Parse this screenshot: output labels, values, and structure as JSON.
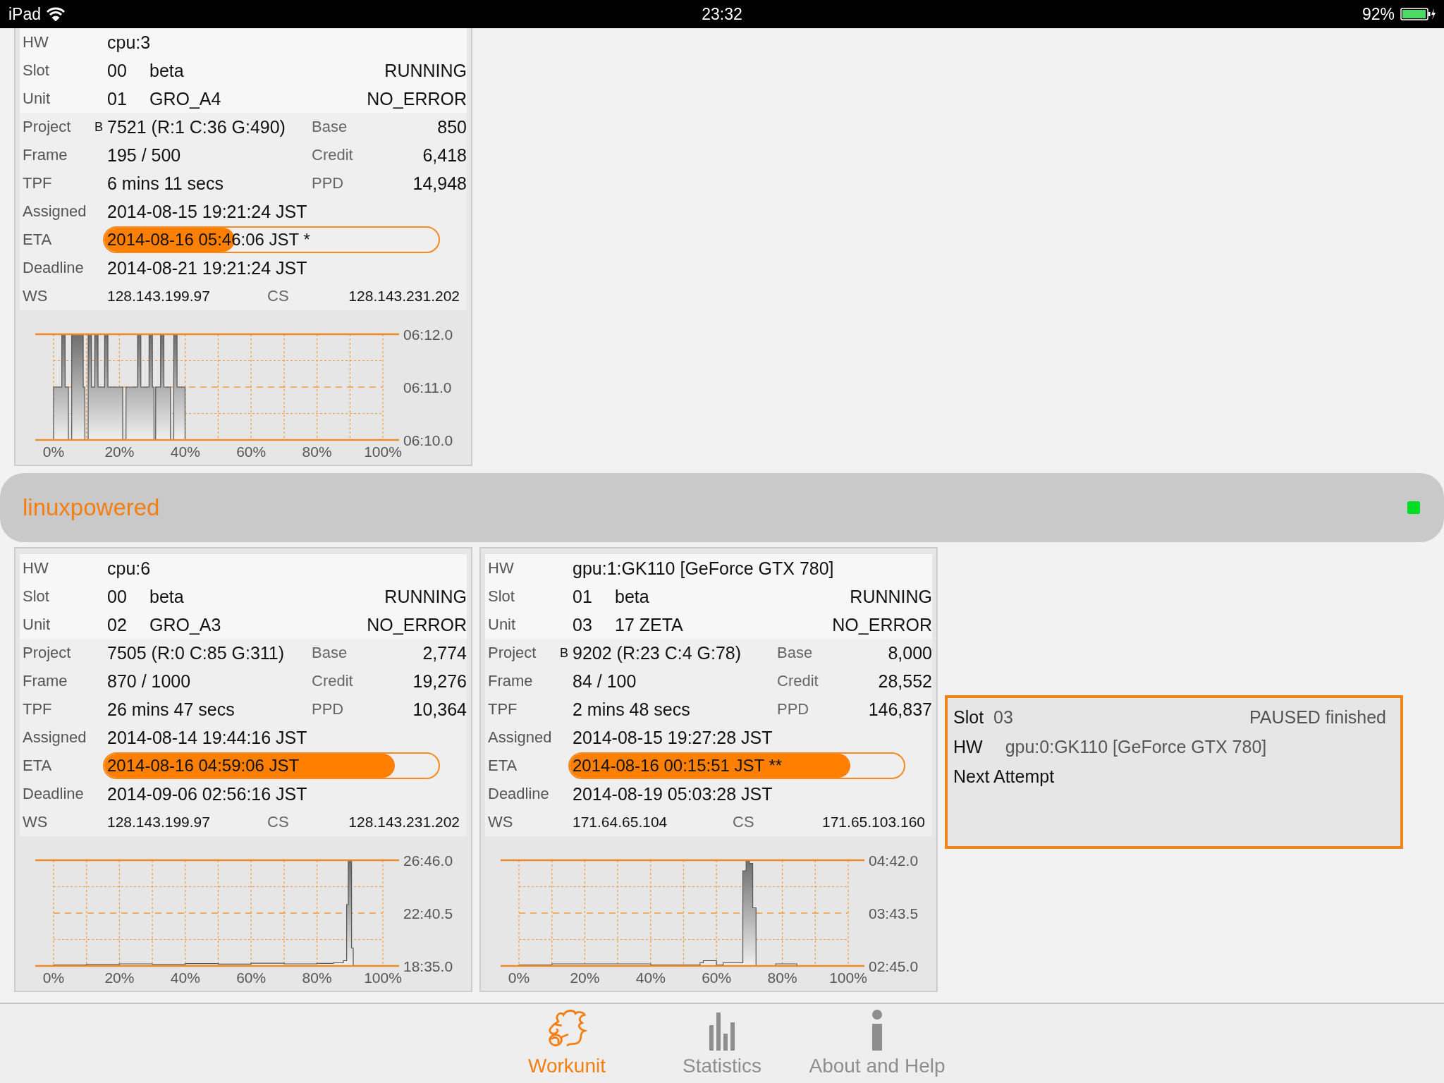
{
  "status_bar": {
    "device": "iPad",
    "time": "23:32",
    "battery": "92%"
  },
  "top_card": {
    "header_rows": [
      {
        "kind": "single",
        "label": "HW",
        "value": "cpu:3"
      },
      {
        "kind": "status",
        "label": "Slot",
        "id": "00",
        "name": "beta",
        "state": "RUNNING"
      },
      {
        "kind": "status",
        "label": "Unit",
        "id": "01",
        "name": "GRO_A4",
        "state": "NO_ERROR"
      }
    ],
    "rows": [
      {
        "kind": "paired",
        "label": "Project",
        "flag": "B",
        "value": "7521 (R:1 C:36 G:490)",
        "side_label": "Base",
        "side_value": "850"
      },
      {
        "kind": "paired",
        "label": "Frame",
        "value": "195 / 500",
        "side_label": "Credit",
        "side_value": "6,418"
      },
      {
        "kind": "paired",
        "label": "TPF",
        "value": "6 mins 11 secs",
        "side_label": "PPD",
        "side_value": "14,948"
      },
      {
        "kind": "single",
        "label": "Assigned",
        "value": "2014-08-15 19:21:24 JST"
      },
      {
        "kind": "progress",
        "label": "ETA",
        "value": "2014-08-16 05:46:06 JST *",
        "level": 0.39
      },
      {
        "kind": "single",
        "label": "Deadline",
        "value": "2014-08-21 19:21:24 JST"
      },
      {
        "kind": "address",
        "label": "WS",
        "value": "128.143.199.97",
        "side_label": "CS",
        "side_value": "128.143.231.202"
      }
    ],
    "graph": {
      "x_labels": [
        "0%",
        "20%",
        "40%",
        "60%",
        "80%",
        "100%"
      ],
      "y_labels": [
        "06:12.0",
        "06:11.0",
        "06:10.0"
      ]
    }
  },
  "host": {
    "name": "linuxpowered",
    "online": true
  },
  "cards": [
    {
      "header_rows": [
        {
          "kind": "single",
          "label": "HW",
          "value": "cpu:6"
        },
        {
          "kind": "status",
          "label": "Slot",
          "id": "00",
          "name": "beta",
          "state": "RUNNING"
        },
        {
          "kind": "status",
          "label": "Unit",
          "id": "02",
          "name": "GRO_A3",
          "state": "NO_ERROR"
        }
      ],
      "rows": [
        {
          "kind": "paired",
          "label": "Project",
          "value": "7505 (R:0 C:85 G:311)",
          "side_label": "Base",
          "side_value": "2,774"
        },
        {
          "kind": "paired",
          "label": "Frame",
          "value": "870 / 1000",
          "side_label": "Credit",
          "side_value": "19,276"
        },
        {
          "kind": "paired",
          "label": "TPF",
          "value": "26 mins 47 secs",
          "side_label": "PPD",
          "side_value": "10,364"
        },
        {
          "kind": "single",
          "label": "Assigned",
          "value": "2014-08-14 19:44:16 JST"
        },
        {
          "kind": "progress",
          "label": "ETA",
          "value": "2014-08-16 04:59:06 JST",
          "level": 0.87
        },
        {
          "kind": "single",
          "label": "Deadline",
          "value": "2014-09-06 02:56:16 JST"
        },
        {
          "kind": "address",
          "label": "WS",
          "value": "128.143.199.97",
          "side_label": "CS",
          "side_value": "128.143.231.202"
        }
      ],
      "graph": {
        "x_labels": [
          "0%",
          "20%",
          "40%",
          "60%",
          "80%",
          "100%"
        ],
        "y_labels": [
          "26:46.0",
          "22:40.5",
          "18:35.0"
        ]
      }
    },
    {
      "header_rows": [
        {
          "kind": "single",
          "label": "HW",
          "value": "gpu:1:GK110 [GeForce GTX 780]"
        },
        {
          "kind": "status",
          "label": "Slot",
          "id": "01",
          "name": "beta",
          "state": "RUNNING"
        },
        {
          "kind": "status",
          "label": "Unit",
          "id": "03",
          "name": "17 ZETA",
          "state": "NO_ERROR"
        }
      ],
      "rows": [
        {
          "kind": "paired",
          "label": "Project",
          "flag": "B",
          "value": "9202 (R:23 C:4 G:78)",
          "side_label": "Base",
          "side_value": "8,000"
        },
        {
          "kind": "paired",
          "label": "Frame",
          "value": "84 / 100",
          "side_label": "Credit",
          "side_value": "28,552"
        },
        {
          "kind": "paired",
          "label": "TPF",
          "value": "2 mins 48 secs",
          "side_label": "PPD",
          "side_value": "146,837"
        },
        {
          "kind": "single",
          "label": "Assigned",
          "value": "2014-08-15 19:27:28 JST"
        },
        {
          "kind": "progress",
          "label": "ETA",
          "value": "2014-08-16 00:15:51 JST **",
          "level": 0.84
        },
        {
          "kind": "single",
          "label": "Deadline",
          "value": "2014-08-19 05:03:28 JST"
        },
        {
          "kind": "address",
          "label": "WS",
          "value": "171.64.65.104",
          "side_label": "CS",
          "side_value": "171.65.103.160"
        }
      ],
      "graph": {
        "x_labels": [
          "0%",
          "20%",
          "40%",
          "60%",
          "80%",
          "100%"
        ],
        "y_labels": [
          "04:42.0",
          "03:43.5",
          "02:45.0"
        ]
      }
    }
  ],
  "paused_slot": {
    "slot_label": "Slot",
    "slot_id": "03",
    "state": "PAUSED finished",
    "hw_label": "HW",
    "hw_value": "gpu:0:GK110 [GeForce GTX 780]",
    "next_label": "Next Attempt"
  },
  "tabs": [
    {
      "kind": "workunit",
      "label": "Workunit",
      "selected": true
    },
    {
      "kind": "statistics",
      "label": "Statistics",
      "selected": false
    },
    {
      "kind": "about",
      "label": "About and Help",
      "selected": false
    }
  ]
}
